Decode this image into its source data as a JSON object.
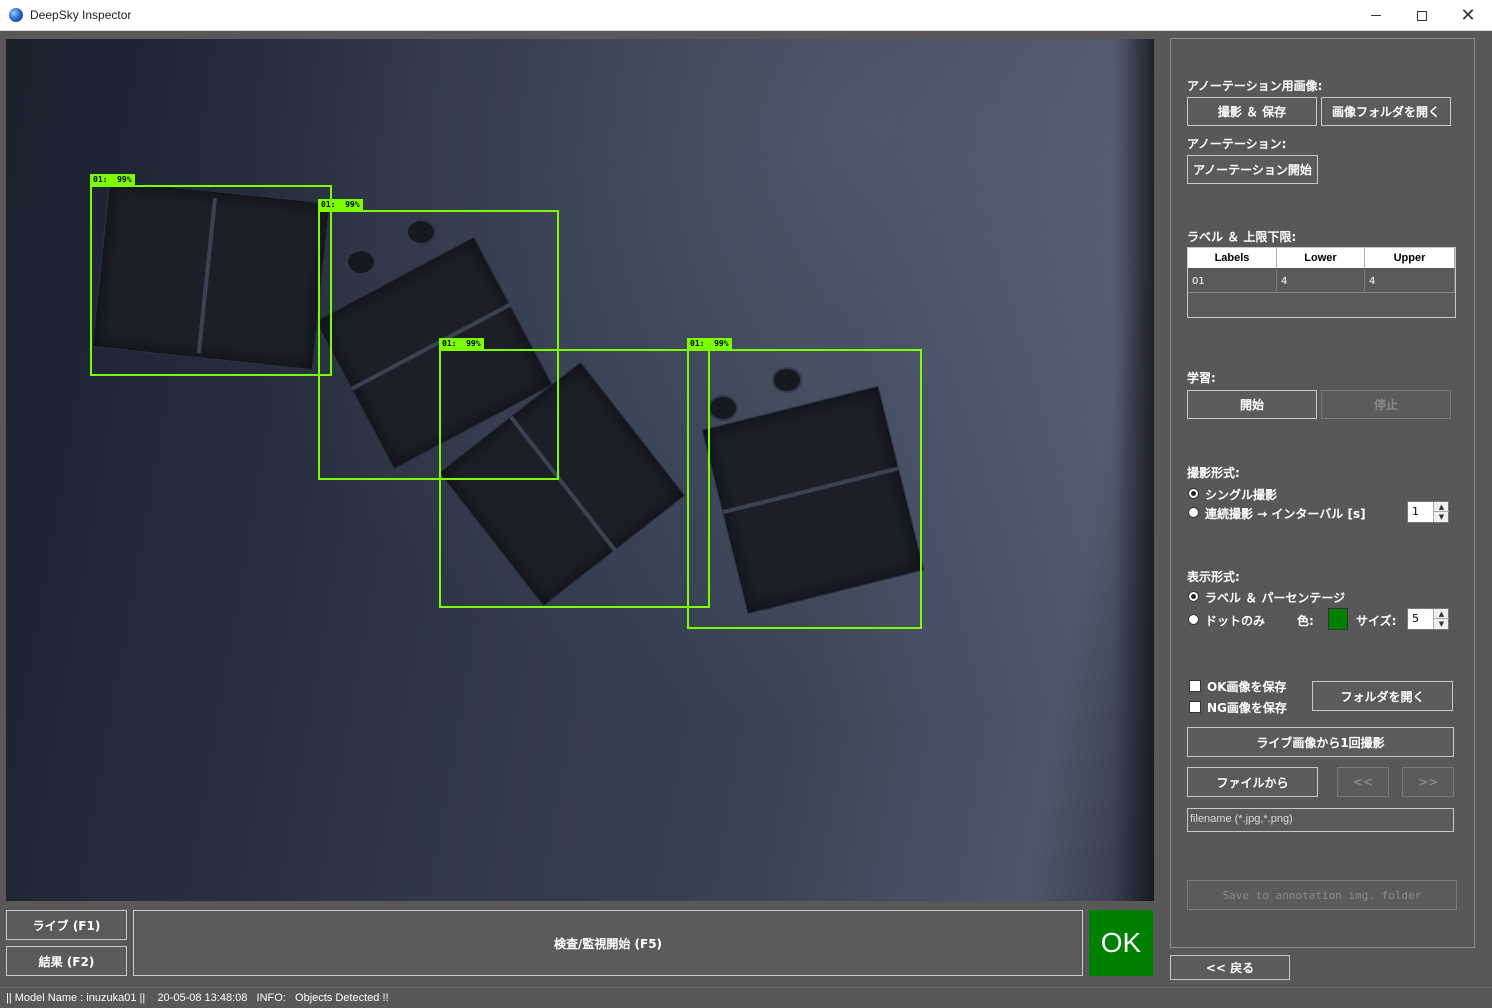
{
  "window": {
    "title": "DeepSky Inspector",
    "min_glyph": "",
    "max_glyph": "",
    "close_glyph": "✕"
  },
  "detections": [
    {
      "label": "01:  99%"
    },
    {
      "label": "01:  99%"
    },
    {
      "label": "01:  99%"
    },
    {
      "label": "01:  99%"
    }
  ],
  "panel": {
    "annotation_images_label": "アノーテーション用画像:",
    "capture_save_button": "撮影 ＆ 保存",
    "open_image_folder_button": "画像フォルダを開く",
    "annotation_label": "アノーテーション:",
    "start_annotation_button": "アノーテーション開始",
    "labels_limits_label": "ラベル ＆ 上限下限:",
    "grid": {
      "headers": [
        "Labels",
        "Lower",
        "Upper"
      ],
      "rows": [
        [
          "01",
          "4",
          "4"
        ]
      ]
    },
    "training_label": "学習:",
    "train_start_button": "開始",
    "train_stop_button": "停止",
    "capture_mode_label": "撮影形式:",
    "single_capture_option": "シングル撮影",
    "continuous_capture_option": "連続撮影 → インターバル [s]",
    "interval_value": "1",
    "display_mode_label": "表示形式:",
    "label_percentage_option": "ラベル ＆ パーセンテージ",
    "dot_only_option": "ドットのみ",
    "color_label": "色:",
    "dot_color": "#008000",
    "size_label": "サイズ:",
    "size_value": "5",
    "save_ok_images": "OK画像を保存",
    "save_ng_images": "NG画像を保存",
    "open_folder_button": "フォルダを開く",
    "capture_once_button": "ライブ画像から1回撮影",
    "from_file_button": "ファイルから",
    "prev_button": "<<",
    "next_button": ">>",
    "filename_placeholder": "filename (*.jpg,*.png)",
    "save_annotation_button": "Save to annotation img. folder",
    "back_button": "<< 戻る"
  },
  "bottom": {
    "live_button": "ライブ (F1)",
    "results_button": "結果 (F2)",
    "inspect_button": "検査/監視開始 (F5)",
    "result_status": "OK"
  },
  "status_bar": {
    "text": "|| Model Name : inuzuka01 ||    20-05-08 13:48:08   INFO:   Objects Detected !!"
  }
}
